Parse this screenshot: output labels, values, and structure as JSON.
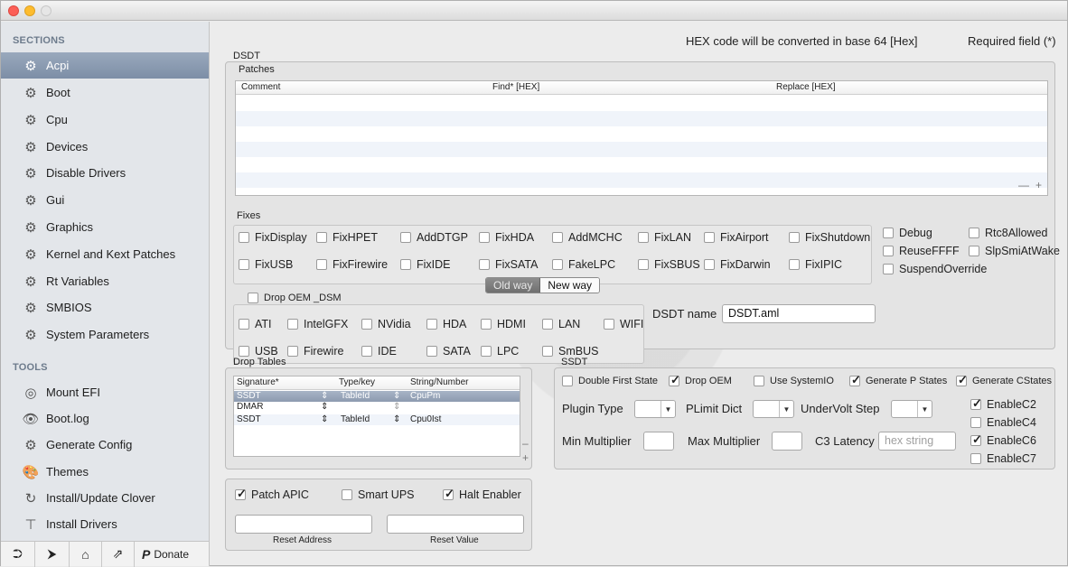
{
  "sidebar": {
    "sections_heading": "SECTIONS",
    "sections": [
      {
        "label": "Acpi",
        "active": true
      },
      {
        "label": "Boot"
      },
      {
        "label": "Cpu"
      },
      {
        "label": "Devices"
      },
      {
        "label": "Disable Drivers"
      },
      {
        "label": "Gui"
      },
      {
        "label": "Graphics"
      },
      {
        "label": "Kernel and Kext Patches"
      },
      {
        "label": "Rt Variables"
      },
      {
        "label": "SMBIOS"
      },
      {
        "label": "System Parameters"
      }
    ],
    "tools_heading": "TOOLS",
    "tools": [
      {
        "label": "Mount EFI",
        "icon": "disk-icon"
      },
      {
        "label": "Boot.log",
        "icon": "eye-icon"
      },
      {
        "label": "Generate Config",
        "icon": "gears-icon"
      },
      {
        "label": "Themes",
        "icon": "palette-icon"
      },
      {
        "label": "Install/Update Clover",
        "icon": "refresh-icon"
      },
      {
        "label": "Install Drivers",
        "icon": "pin-icon"
      }
    ],
    "footer": {
      "donate_label": "Donate"
    }
  },
  "header": {
    "hex_note": "HEX code will be converted in base 64 [Hex]",
    "required_note": "Required field (*)"
  },
  "dsdt": {
    "label": "DSDT",
    "patches_label": "Patches",
    "patches_columns": [
      "Comment",
      "Find* [HEX]",
      "Replace [HEX]"
    ],
    "fixes_label": "Fixes",
    "fixes_row1": [
      {
        "label": "FixDisplay",
        "checked": false
      },
      {
        "label": "FixHPET",
        "checked": false
      },
      {
        "label": "AddDTGP",
        "checked": false
      },
      {
        "label": "FixHDA",
        "checked": false
      },
      {
        "label": "AddMCHC",
        "checked": false
      },
      {
        "label": "FixLAN",
        "checked": false
      },
      {
        "label": "FixAirport",
        "checked": false
      },
      {
        "label": "FixShutdown",
        "checked": false
      }
    ],
    "fixes_row2": [
      {
        "label": "FixUSB",
        "checked": false
      },
      {
        "label": "FixFirewire",
        "checked": false
      },
      {
        "label": "FixIDE",
        "checked": false
      },
      {
        "label": "FixSATA",
        "checked": false
      },
      {
        "label": "FakeLPC",
        "checked": false
      },
      {
        "label": "FixSBUS",
        "checked": false
      },
      {
        "label": "FixDarwin",
        "checked": false
      },
      {
        "label": "FixIPIC",
        "checked": false
      }
    ],
    "side_fixes": [
      {
        "label": "Debug",
        "checked": false
      },
      {
        "label": "Rtc8Allowed",
        "checked": false
      },
      {
        "label": "ReuseFFFF",
        "checked": false
      },
      {
        "label": "SlpSmiAtWake",
        "checked": false
      },
      {
        "label": "SuspendOverride",
        "checked": false
      }
    ],
    "mode_old": "Old way",
    "mode_new": "New way",
    "drop_oem_dsm_label": "Drop OEM _DSM",
    "dsm_row1": [
      {
        "label": "ATI",
        "checked": false
      },
      {
        "label": "IntelGFX",
        "checked": false
      },
      {
        "label": "NVidia",
        "checked": false
      },
      {
        "label": "HDA",
        "checked": false
      },
      {
        "label": "HDMI",
        "checked": false
      },
      {
        "label": "LAN",
        "checked": false
      },
      {
        "label": "WIFI",
        "checked": false
      }
    ],
    "dsm_row2": [
      {
        "label": "USB",
        "checked": false
      },
      {
        "label": "Firewire",
        "checked": false
      },
      {
        "label": "IDE",
        "checked": false
      },
      {
        "label": "SATA",
        "checked": false
      },
      {
        "label": "LPC",
        "checked": false
      },
      {
        "label": "SmBUS",
        "checked": false
      }
    ],
    "dsdt_name_label": "DSDT name",
    "dsdt_name_value": "DSDT.aml"
  },
  "drop_tables": {
    "label": "Drop Tables",
    "columns": [
      "Signature*",
      "Type/key",
      "String/Number"
    ],
    "rows": [
      {
        "signature": "SSDT",
        "type": "TableId",
        "value": "CpuPm",
        "selected": true
      },
      {
        "signature": "DMAR",
        "type": "",
        "value": ""
      },
      {
        "signature": "SSDT",
        "type": "TableId",
        "value": "Cpu0Ist"
      }
    ]
  },
  "ssdt": {
    "label": "SSDT",
    "options": [
      {
        "label": "Double First State",
        "checked": false
      },
      {
        "label": "Drop OEM",
        "checked": true
      },
      {
        "label": "Use SystemIO",
        "checked": false
      },
      {
        "label": "Generate P States",
        "checked": true
      },
      {
        "label": "Generate CStates",
        "checked": true
      }
    ],
    "plugin_type_label": "Plugin Type",
    "plimit_dict_label": "PLimit Dict",
    "undervolt_label": "UnderVolt Step",
    "min_mult_label": "Min Multiplier",
    "max_mult_label": "Max Multiplier",
    "c3_latency_label": "C3 Latency",
    "c3_latency_placeholder": "hex string",
    "cstates": [
      {
        "label": "EnableC2",
        "checked": true
      },
      {
        "label": "EnableC4",
        "checked": false
      },
      {
        "label": "EnableC6",
        "checked": true
      },
      {
        "label": "EnableC7",
        "checked": false
      }
    ]
  },
  "apic": {
    "patch_apic": {
      "label": "Patch APIC",
      "checked": true
    },
    "smart_ups": {
      "label": "Smart UPS",
      "checked": false
    },
    "halt_enabler": {
      "label": "Halt Enabler",
      "checked": true
    },
    "reset_address_label": "Reset Address",
    "reset_value_label": "Reset Value"
  }
}
